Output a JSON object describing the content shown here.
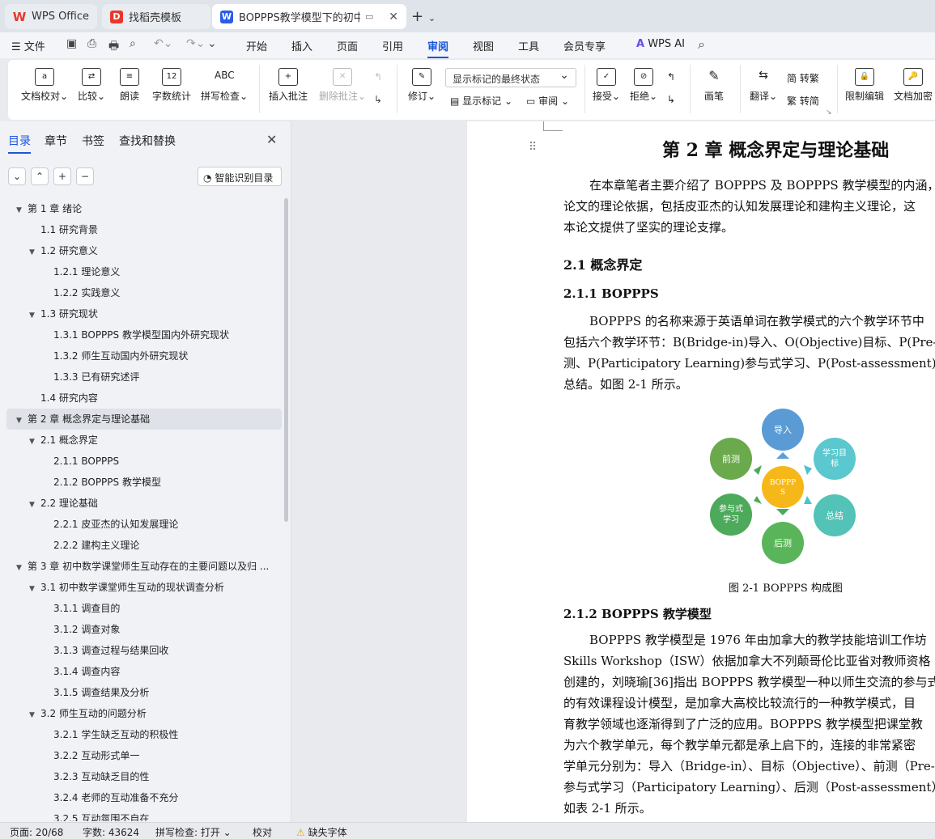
{
  "tabs": [
    {
      "label": "WPS Office",
      "icon": "wps-logo-icon",
      "color": "#e8382c"
    },
    {
      "label": "找稻壳模板",
      "icon": "docer-icon",
      "color": "#e8382c"
    },
    {
      "label": "BOPPPS教学模型下的初中数",
      "icon": "writer-doc-icon",
      "color": "#2b5ce6",
      "active": true
    }
  ],
  "menu": {
    "file": "文件",
    "items": [
      "开始",
      "插入",
      "页面",
      "引用",
      "审阅",
      "视图",
      "工具",
      "会员专享"
    ],
    "active": "审阅",
    "ai": "WPS AI"
  },
  "ribbon": {
    "doc_check": "文档校对",
    "compare": "比较",
    "read": "朗读",
    "word_count": "字数统计",
    "spell": "拼写检查",
    "insert_comment": "插入批注",
    "delete_comment": "删除批注",
    "revise": "修订",
    "markup_state": "显示标记的最终状态",
    "show_markup": "显示标记",
    "review": "审阅",
    "accept": "接受",
    "reject": "拒绝",
    "pen": "画笔",
    "translate": "翻译",
    "to_trad": "转繁",
    "to_simp": "转简",
    "restrict": "限制编辑",
    "encrypt": "文档加密"
  },
  "panel": {
    "tabs": [
      "目录",
      "章节",
      "书签",
      "查找和替换"
    ],
    "smart_toc": "智能识别目录",
    "toc": [
      {
        "t": "第 1 章  绪论",
        "l": 0,
        "arr": true
      },
      {
        "t": "1.1  研究背景",
        "l": 1
      },
      {
        "t": "1.2  研究意义",
        "l": 1,
        "arr": true
      },
      {
        "t": "1.2.1 理论意义",
        "l": 2
      },
      {
        "t": "1.2.2 实践意义",
        "l": 2
      },
      {
        "t": "1.3  研究现状",
        "l": 1,
        "arr": true
      },
      {
        "t": "1.3.1 BOPPPS 教学模型国内外研究现状",
        "l": 2
      },
      {
        "t": "1.3.2  师生互动国内外研究现状",
        "l": 2
      },
      {
        "t": "1.3.3 已有研究述评",
        "l": 2
      },
      {
        "t": "1.4  研究内容",
        "l": 1
      },
      {
        "t": "第 2 章  概念界定与理论基础",
        "l": 0,
        "arr": true,
        "sel": true
      },
      {
        "t": "2.1 概念界定",
        "l": 1,
        "arr": true
      },
      {
        "t": "2.1.1 BOPPPS",
        "l": 2
      },
      {
        "t": "2.1.2 BOPPPS 教学模型",
        "l": 2
      },
      {
        "t": "2.2 理论基础",
        "l": 1,
        "arr": true
      },
      {
        "t": "2.2.1 皮亚杰的认知发展理论",
        "l": 2
      },
      {
        "t": "2.2.2 建构主义理论",
        "l": 2
      },
      {
        "t": "第 3 章  初中数学课堂师生互动存在的主要问题以及归 ...",
        "l": 0,
        "arr": true
      },
      {
        "t": "3.1 初中数学课堂师生互动的现状调查分析",
        "l": 1,
        "arr": true
      },
      {
        "t": "3.1.1 调查目的",
        "l": 2
      },
      {
        "t": "3.1.2 调查对象",
        "l": 2
      },
      {
        "t": "3.1.3 调查过程与结果回收",
        "l": 2
      },
      {
        "t": "3.1.4 调查内容",
        "l": 2
      },
      {
        "t": "3.1.5 调查结果及分析",
        "l": 2
      },
      {
        "t": "3.2 师生互动的问题分析",
        "l": 1,
        "arr": true
      },
      {
        "t": "3.2.1 学生缺乏互动的积极性",
        "l": 2
      },
      {
        "t": "3.2.2 互动形式单一",
        "l": 2
      },
      {
        "t": "3.2.3 互动缺乏目的性",
        "l": 2
      },
      {
        "t": "3.2.4 老师的互动准备不充分",
        "l": 2
      },
      {
        "t": "3.2.5 互动氛围不自在",
        "l": 2
      }
    ]
  },
  "doc": {
    "chapter_title": "第 2 章  概念界定与理论基础",
    "intro": [
      "在本章笔者主要介绍了 BOPPPS 及 BOPPPS 教学模型的内涵，",
      "论文的理论依据，包括皮亚杰的认知发展理论和建构主义理论，这",
      "本论文提供了坚实的理论支撑。"
    ],
    "h_2_1": "2.1 概念界定",
    "h_2_1_1": "2.1.1 BOPPPS",
    "p_boppps": [
      "BOPPPS 的名称来源于英语单词在教学模式的六个教学环节中",
      "包括六个教学环节：B(Bridge-in)导入、O(Objective)目标、P(Pre-as",
      "测、P(Participatory Learning)参与式学习、P(Post-assessment)后测、",
      "总结。如图 2-1 所示。"
    ],
    "diagram": {
      "center": "BOPPP S",
      "nodes": [
        "导入",
        "学习目标",
        "总结",
        "后测",
        "参与式学习",
        "前测"
      ]
    },
    "caption": "图 2-1 BOPPPS 构成图",
    "h_2_1_2": "2.1.2 BOPPPS 教学模型",
    "p_model": [
      "BOPPPS 教学模型是 1976 年由加拿大的教学技能培训工作坊",
      "Skills Workshop（ISW）依据加拿大不列颠哥伦比亚省对教师资格",
      "创建的，刘晓瑜[36]指出 BOPPPS 教学模型一种以师生交流的参与式",
      "的有效课程设计模型，是加拿大高校比较流行的一种教学模式，目",
      "育教学领域也逐渐得到了广泛的应用。BOPPPS 教学模型把课堂教",
      "为六个教学单元，每个教学单元都是承上启下的，连接的非常紧密",
      "学单元分别为：导入（Bridge-in）、目标（Objective）、前测（Pre-a",
      "参与式学习（Participatory Learning）、后测（Post-assessment）与总结",
      "如表 2-1 所示。"
    ]
  },
  "status": {
    "page": "页面: 20/68",
    "words": "字数: 43624",
    "spell": "拼写检查: 打开",
    "proof": "校对",
    "font": "缺失字体"
  }
}
